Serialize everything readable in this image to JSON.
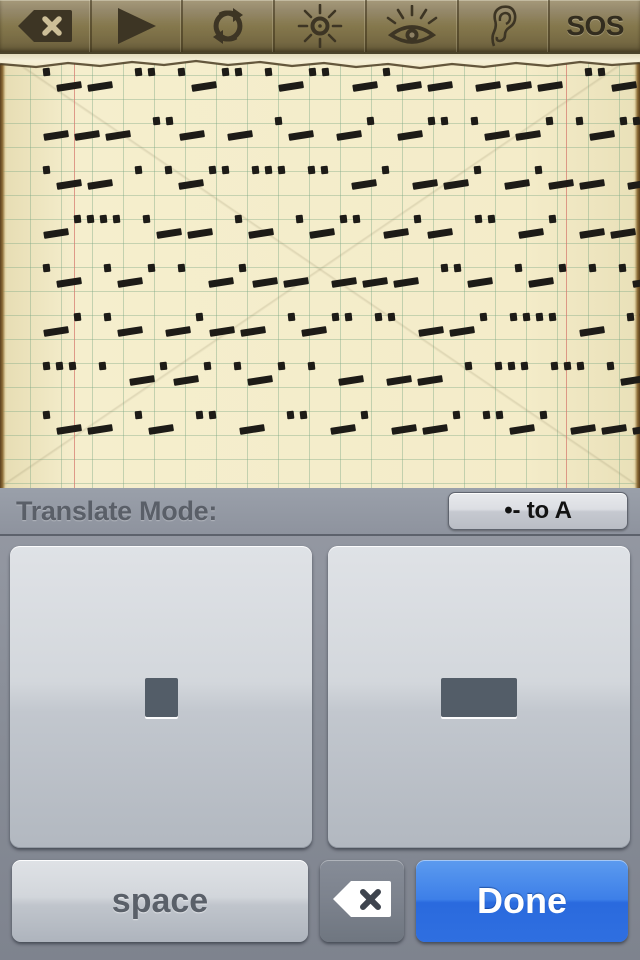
{
  "toolbar": {
    "buttons": [
      {
        "name": "clear-button",
        "icon": "backspace-icon",
        "label": ""
      },
      {
        "name": "play-button",
        "icon": "play-icon",
        "label": ""
      },
      {
        "name": "loop-button",
        "icon": "loop-icon",
        "label": ""
      },
      {
        "name": "flash-button",
        "icon": "sun-flash-icon",
        "label": ""
      },
      {
        "name": "visual-button",
        "icon": "eye-icon",
        "label": ""
      },
      {
        "name": "audio-button",
        "icon": "ear-icon",
        "label": ""
      },
      {
        "name": "sos-button",
        "icon": "sos-text",
        "label": "SOS"
      }
    ]
  },
  "paper": {
    "morse_lines": [
      ".-- .. .-.. .-.. -.-- --- ..- .--. .-.. . .- ... . -.-. --- -- .",
      "--- ..- - .- -. -.. .--. .-.. .- -.-- .. -. - .... . ... -. --- .--",
      ".-- . .-.. ... .. -. --. -.-- --- ..- .-. ..-. .-. .. . -. -.. ... .... .. .--.",
      "-.... .-- .- .-.. -.- .. -. --. .. -. - .... . -- --- .-. -. .. -. --.",
      ".- .-. . -.-- --- ..- .-. . .- -.. -.-- ... --- --- -. .-",
      "-. .- -.-- .-.. .. --. .... - ... --- ..-. - .... . ... -.- -.--",
      "... . -.-. .-. . - -- . ... ... .- --. . ... .. -. -- --- .-. ... .",
      ".-- .- .. - .. -. --. ..-. --- .-. .- .-. . .--. .-.. -.--"
    ]
  },
  "mode": {
    "label": "Translate Mode:",
    "button_label": "•- to A"
  },
  "keys": {
    "dot_key_name": "dot",
    "dash_key_name": "dash"
  },
  "actions": {
    "space_label": "space",
    "backspace_label": "",
    "done_label": "Done"
  },
  "colors": {
    "toolbar": "#85784c",
    "toolbar_ink": "#3d3524",
    "paper": "#f3ebc9",
    "grid_line": "#78a582",
    "margin_line": "#d6786e",
    "panel": "#8a8f99",
    "key_face": "#d3d7dc",
    "glyph": "#535d68",
    "done_blue": "#2f6fe0",
    "mode_label": "#5a5f68"
  }
}
